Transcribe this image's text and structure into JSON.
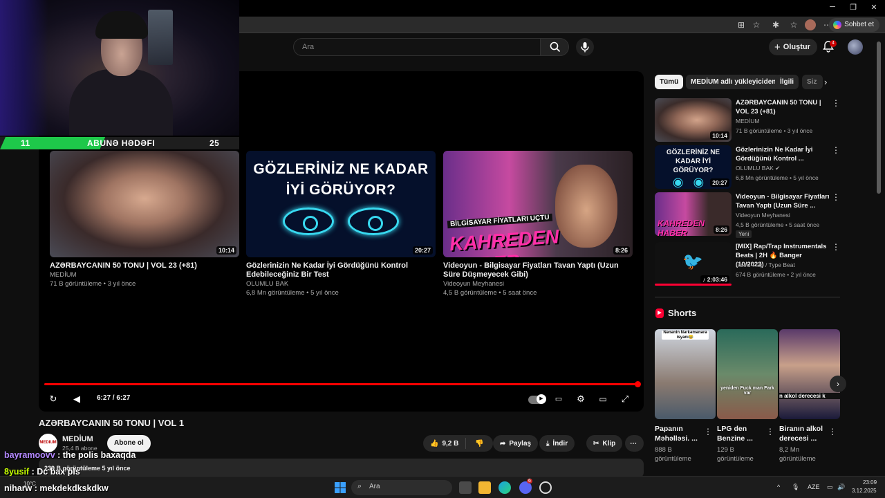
{
  "browser": {
    "copilot_label": "Sohbet et",
    "tab_count_badge": "4"
  },
  "stream": {
    "goal_current": "11",
    "goal_label": "ABUNƏ HƏDƏFI",
    "goal_target": "25",
    "goal_progress": 0.44,
    "chat": [
      {
        "user": "bayramoovv",
        "message": "the polis baxaqda",
        "user_color": "#b388ff"
      },
      {
        "user": "8yusif",
        "message": "Dc bax pls",
        "user_color": "#c6ff00"
      },
      {
        "user": "niharw",
        "message": "mekdekdkskdkw",
        "user_color": "#ffffff"
      }
    ]
  },
  "header": {
    "search_placeholder": "Ara",
    "create_label": "Oluştur",
    "notifications": "4"
  },
  "player": {
    "time": "6:27 / 6:27",
    "progress": 1.0,
    "end_screen": [
      {
        "title": "AZƏRBAYCANIN 50 TONU | VOL 23 (+81)",
        "channel": "MEDİUM",
        "meta": "71 B görüntüleme • 3 yıl önce",
        "duration": "10:14"
      },
      {
        "title": "Gözlerinizin Ne Kadar İyi Gördüğünü Kontrol Edebileceğiniz Bir Test",
        "channel": "OLUMLU BAK",
        "meta": "6,8 Mn görüntüleme • 5 yıl önce",
        "duration": "20:27",
        "thumb_text": "GÖZLERİNİZ NE KADAR İYİ GÖRÜYOR?"
      },
      {
        "title": "Videoyun - Bilgisayar Fiyatları Tavan Yaptı (Uzun Süre Düşmeyecek Gibi)",
        "channel": "Videoyun Meyhanesi",
        "meta": "4,5 B görüntüleme • 5 saat önce",
        "duration": "8:26",
        "thumb_band": "BİLGİSAYAR FİYATLARI UÇTU",
        "thumb_text": "KAHREDEN HABER"
      }
    ]
  },
  "video": {
    "title": "AZƏRBAYCANIN 50 TONU | VOL 1",
    "channel": "MEDİUM",
    "channel_avatar_text": "MEDIUM",
    "subscribers": "25,4 B abone",
    "subscribe_label": "Abone ol",
    "likes": "9,2 B",
    "share_label": "Paylaş",
    "download_label": "İndir",
    "clip_label": "Klip",
    "description_meta": "239 B görüntüleme   5 yıl önce"
  },
  "sidebar": {
    "chips": [
      {
        "label": "Tümü",
        "active": true
      },
      {
        "label": "MEDİUM adlı yükleyiciden",
        "active": false
      },
      {
        "label": "İlgili",
        "active": false
      },
      {
        "label": "Siz",
        "active": false
      }
    ],
    "items": [
      {
        "title": "AZƏRBAYCANIN 50 TONU | VOL 23 (+81)",
        "channel": "MEDİUM",
        "meta": "71 B görüntüleme • 3 yıl önce",
        "duration": "10:14"
      },
      {
        "title": "Gözlerinizin Ne Kadar İyi Gördüğünü Kontrol ...",
        "channel": "OLUMLU BAK",
        "meta": "6,8 Mn görüntüleme • 5 yıl önce",
        "duration": "20:27",
        "thumb_text": "GÖZLERİNİZ NE KADAR İYİ GÖRÜYOR?"
      },
      {
        "title": "Videoyun - Bilgisayar Fiyatları Tavan Yaptı (Uzun Süre ...",
        "channel": "Videoyun Meyhanesi",
        "meta": "4,5 B görüntüleme • 5 saat önce",
        "duration": "8:26",
        "badge": "Yeni",
        "thumb_text": "KAHREDEN HABER"
      },
      {
        "title": "[MIX] Rap/Trap Instrumentals Beats | 2H 🔥 Banger (10/2023)",
        "channel": "Instru Trap / Type Beat",
        "meta": "674 B görüntüleme • 2 yıl önce",
        "duration": "2:03:46"
      }
    ],
    "shorts_label": "Shorts",
    "shorts": [
      {
        "title": "Papanın Məhəlləsi. ...",
        "views": "888 B görüntüleme",
        "caption": "Nənənin Nərkəmənərə isyanı😂"
      },
      {
        "title": "LPG den Benzine ...",
        "views": "129 B görüntüleme",
        "caption": "yeniden Fuck man Fark var"
      },
      {
        "title": "Biranın alkol derecesi ...",
        "views": "8,2 Mn görüntüleme",
        "caption": "n alkol derecesi k"
      }
    ]
  },
  "taskbar": {
    "weather": "10°C",
    "search_label": "Ara",
    "language": "AZE",
    "time": "23:09",
    "date": "3.12.2025",
    "discord_badge": "6"
  },
  "colors": {
    "accent_red": "#ff0000",
    "goal_green": "#1ec84a",
    "background": "#0f0f0f"
  }
}
